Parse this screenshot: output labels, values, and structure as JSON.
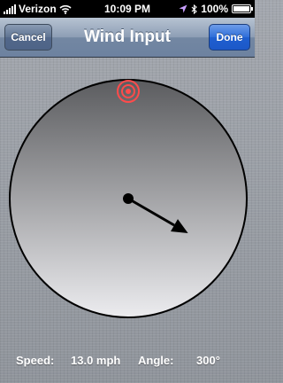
{
  "status_bar": {
    "carrier": "Verizon",
    "time": "10:09 PM",
    "battery": "100%",
    "battery_level": 1.0,
    "icons": [
      "signal-bars-icon",
      "wifi-icon",
      "location-arrow-icon",
      "battery-icon"
    ]
  },
  "nav_bar": {
    "title": "Wind Input",
    "cancel_label": "Cancel",
    "done_label": "Done"
  },
  "wind_dial": {
    "angle_deg": 300,
    "speed_mph": 13.0,
    "target_icon": "target-icon",
    "colors": {
      "target": "#ff4b4b",
      "dial_top": "#5b5c5f",
      "dial_bottom": "#ececef"
    }
  },
  "footer": {
    "speed_label": "Speed:",
    "speed_value": "13.0 mph",
    "angle_label": "Angle:",
    "angle_value": "300°"
  }
}
